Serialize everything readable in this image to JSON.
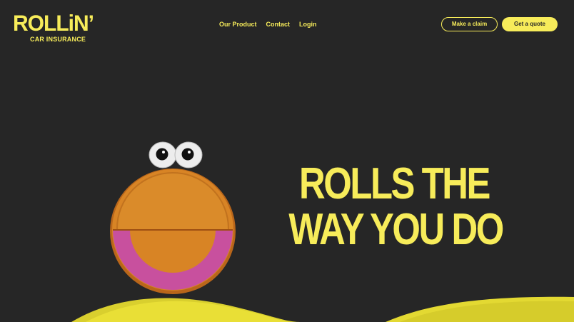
{
  "brand": {
    "name": "ROLLiN’",
    "tagline": "CAR INSURANCE"
  },
  "nav": {
    "items": [
      {
        "label": "Our Product"
      },
      {
        "label": "Contact"
      },
      {
        "label": "Login"
      }
    ]
  },
  "actions": {
    "claim_label": "Make a claim",
    "quote_label": "Get a quote"
  },
  "hero": {
    "line1": "ROLLS THE",
    "line2": "WAY YOU DO"
  },
  "colors": {
    "background": "#262626",
    "accent": "#F7EC5A",
    "mascot_body": "#D88425",
    "mascot_smile": "#C8509E"
  },
  "illustration": {
    "mascot": "smiling-wheel-character-icon",
    "ground": "yellow-hills"
  }
}
